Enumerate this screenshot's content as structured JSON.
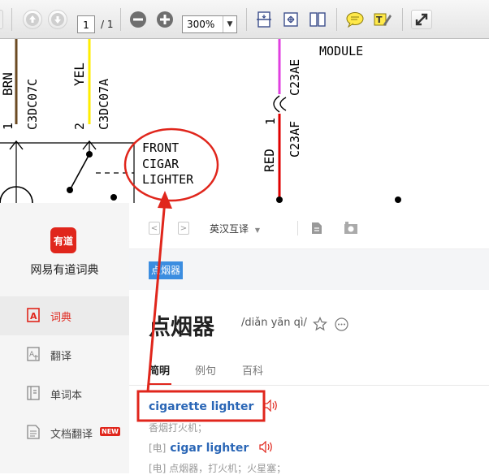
{
  "pdf_toolbar": {
    "page_current": "1",
    "page_total": "/ 1",
    "zoom": "300%",
    "icons": [
      "prev-page-icon",
      "next-page-icon",
      "zoom-out-icon",
      "zoom-in-icon",
      "fit-page-icon",
      "fit-width-icon",
      "two-page-icon",
      "comment-icon",
      "highlight-icon",
      "expand-icon"
    ]
  },
  "pdf_doc": {
    "wire_brn": "BRN",
    "wire_brn_code": "C3DC07C",
    "wire_yel": "YEL",
    "wire_yel_code": "C3DC07A",
    "pin_1": "1",
    "pin_2": "2",
    "label_line1": "FRONT",
    "label_line2": "CIGAR",
    "label_line3": "LIGHTER",
    "module": "MODULE",
    "wire_c23ae": "C23AE",
    "wire_red": "RED",
    "pin_1_right": "1",
    "wire_c23af": "C23AF",
    "colors": {
      "brn": "#6b4a22",
      "yel": "#ffee00",
      "magenta": "#e040e0",
      "red": "#e00000",
      "annotation": "#e0261c"
    }
  },
  "dict": {
    "logo_text": "有道",
    "app_name": "网易有道词典",
    "nav": [
      {
        "label": "词典",
        "icon": "dictionary-icon",
        "active": true
      },
      {
        "label": "翻译",
        "icon": "translate-icon",
        "active": false
      },
      {
        "label": "单词本",
        "icon": "wordbook-icon",
        "active": false
      },
      {
        "label": "文档翻译",
        "icon": "document-translate-icon",
        "active": false,
        "badge": "NEW"
      }
    ],
    "mode": "英汉互译",
    "query": "点烟器",
    "headword": "点烟器",
    "phonetic": "/diǎn yān qì/",
    "tabs": [
      "简明",
      "例句",
      "百科"
    ],
    "entries": [
      {
        "tag": "",
        "word": "cigarette lighter",
        "gloss": "香烟打火机；"
      },
      {
        "tag": "[电]",
        "word": "cigar lighter",
        "gloss": "[电] 点烟器，打火机；火星塞；"
      }
    ],
    "accent": "#e0261c",
    "link_color": "#2a66b6"
  }
}
